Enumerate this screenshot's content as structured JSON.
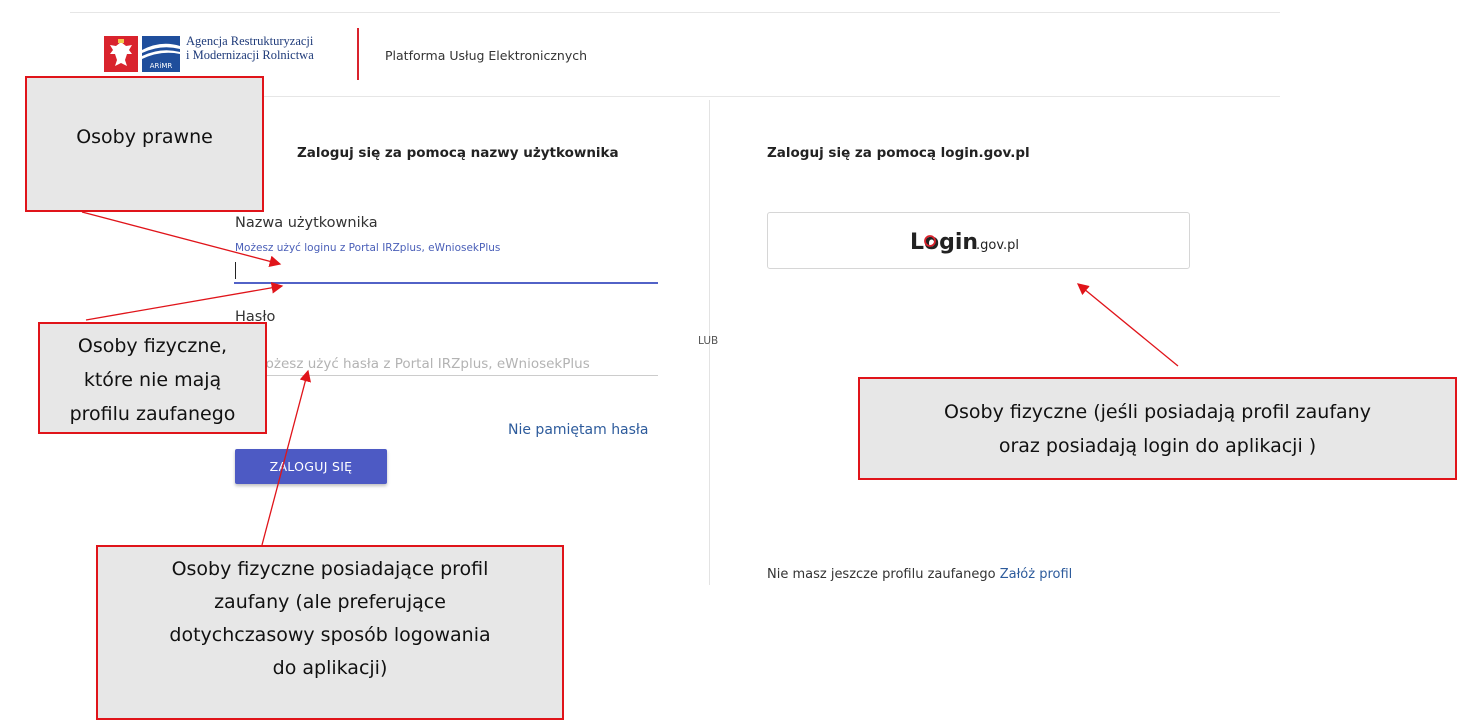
{
  "header": {
    "agency_line1": "Agencja Restrukturyzacji",
    "agency_line2": "i Modernizacji Rolnictwa",
    "platform_title": "Platforma Usług Elektronicznych",
    "logo_text": "ARiMR"
  },
  "left_panel": {
    "heading": "Zaloguj się za pomocą nazwy użytkownika",
    "username_label": "Nazwa użytkownika",
    "username_hint": "Możesz użyć loginu z Portal IRZplus, eWniosekPlus",
    "username_value": "",
    "password_label": "Hasło",
    "password_placeholder": "Możesz użyć hasła z Portal IRZplus, eWniosekPlus",
    "forgot_password": "Nie pamiętam hasła",
    "login_button": "ZALOGUJ SIĘ"
  },
  "divider": {
    "label": "LUB"
  },
  "right_panel": {
    "heading": "Zaloguj się za pomocą login.gov.pl",
    "gov_login_brand": "Login",
    "gov_login_domain": ".gov.pl",
    "no_profile_text": "Nie masz jeszcze profilu zaufanego",
    "create_profile_link": "Załóż profil"
  },
  "annotations": {
    "legal_persons": "Osoby prawne",
    "natural_no_profile": [
      "Osoby fizyczne,",
      "które nie mają",
      "profilu zaufanego"
    ],
    "natural_with_profile_gov": [
      "Osoby fizyczne (jeśli posiadają profil zaufany",
      "oraz posiadają login do aplikacji )"
    ],
    "natural_with_profile_classic": [
      "Osoby fizyczne posiadające profil",
      "zaufany (ale preferujące",
      "dotychczasowy sposób logowania",
      "do aplikacji)"
    ]
  },
  "colors": {
    "primary_button": "#4d5ac4",
    "link": "#2d5b9c",
    "annotation_border": "#e0141a",
    "annotation_fill": "#e7e7e7",
    "header_divider": "#d9232d"
  }
}
